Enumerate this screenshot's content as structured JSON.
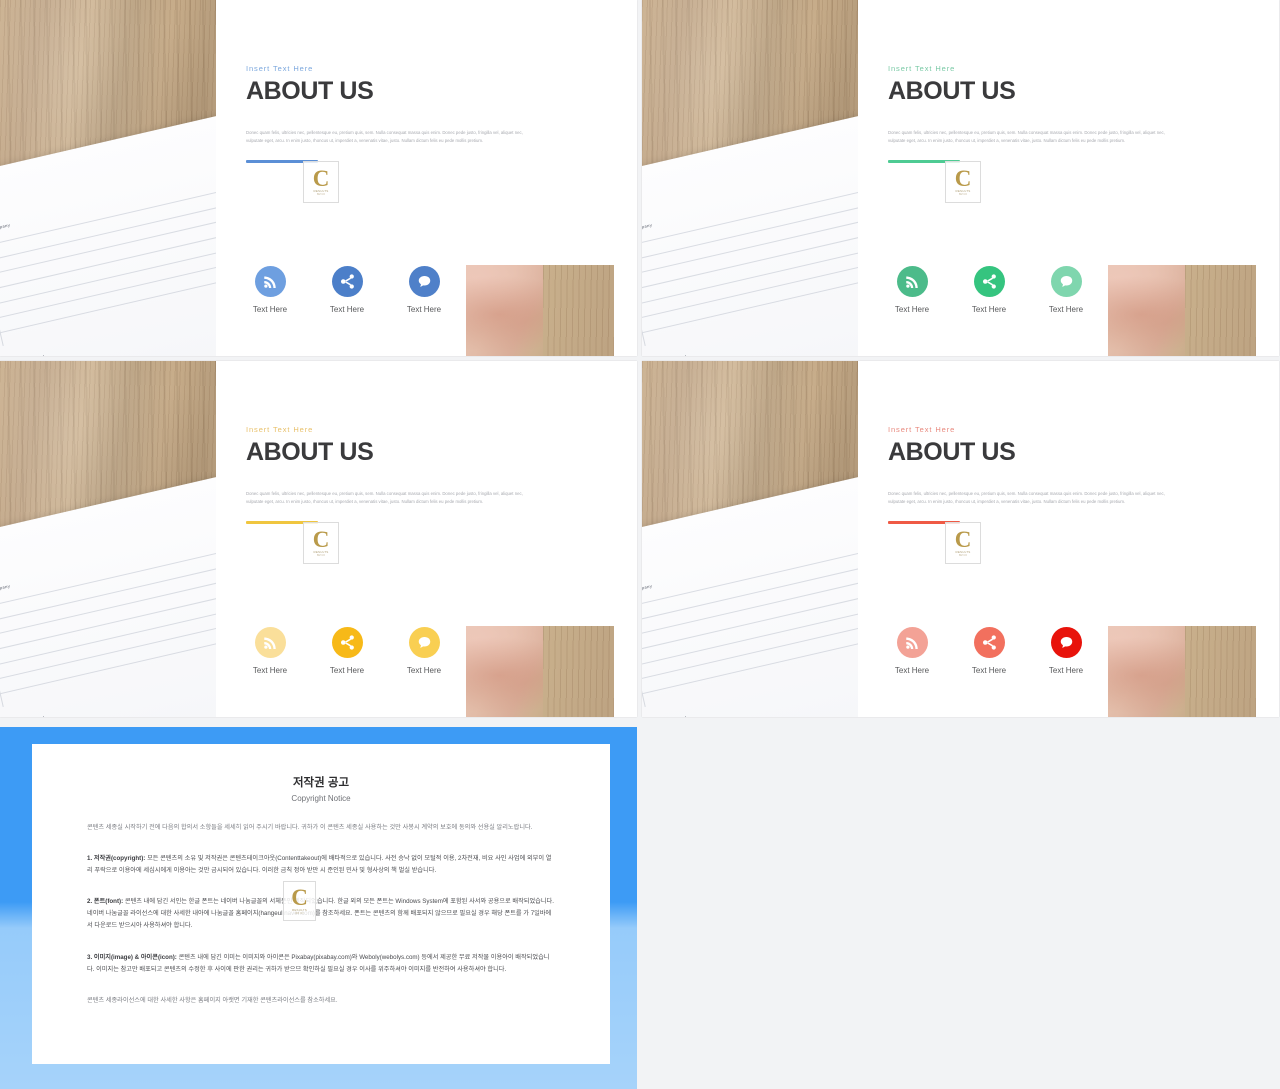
{
  "slides": [
    {
      "id": "slide-blue",
      "eyebrow": "Insert  Text Here",
      "eyebrow_color": "#7ba7dd",
      "headline": "ABOUT US",
      "body": "Donec quam felis, ultricies nec, pellentesque eu, pretium quis, sem. Nulla consequat massa quis enim. Donec pede justo, fringilla vel, aliquet nec, vulputate eget, arcu. In enim justo, rhoncus ut, imperdiet a, venenatis vitae, justo. Nullam dictum felis eu pede mollis pretium.",
      "accent": "#5b8fd6",
      "rule_color": "#5b8fd6",
      "icons": [
        {
          "name": "rss-icon",
          "label": "Text Here",
          "color": "#6e9fe0"
        },
        {
          "name": "share-icon",
          "label": "Text Here",
          "color": "#4c7fc9"
        },
        {
          "name": "chat-icon",
          "label": "Text Here",
          "color": "#4f80c9"
        }
      ]
    },
    {
      "id": "slide-green",
      "eyebrow": "Insert  Text Here",
      "eyebrow_color": "#79c9a5",
      "headline": "ABOUT US",
      "body": "Donec quam felis, ultricies nec, pellentesque eu, pretium quis, sem. Nulla consequat massa quis enim. Donec pede justo, fringilla vel, aliquet nec, vulputate eget, arcu. In enim justo, rhoncus ut, imperdiet a, venenatis vitae, justo. Nullam dictum felis eu pede mollis pretium.",
      "accent": "#4ecb93",
      "rule_color": "#4ecb93",
      "icons": [
        {
          "name": "rss-icon",
          "label": "Text Here",
          "color": "#4cbb8a"
        },
        {
          "name": "share-icon",
          "label": "Text Here",
          "color": "#35c47f"
        },
        {
          "name": "chat-icon",
          "label": "Text Here",
          "color": "#7fd6ae"
        }
      ]
    },
    {
      "id": "slide-yellow",
      "eyebrow": "Insert  Text Here",
      "eyebrow_color": "#e8c06a",
      "headline": "ABOUT US",
      "body": "Donec quam felis, ultricies nec, pellentesque eu, pretium quis, sem. Nulla consequat massa quis enim. Donec pede justo, fringilla vel, aliquet nec, vulputate eget, arcu. In enim justo, rhoncus ut, imperdiet a, venenatis vitae, justo. Nullam dictum felis eu pede mollis pretium.",
      "accent": "#f3cc52",
      "rule_color": "#f0c63f",
      "icons": [
        {
          "name": "rss-icon",
          "label": "Text Here",
          "color": "#fadf9a"
        },
        {
          "name": "share-icon",
          "label": "Text Here",
          "color": "#f7b918"
        },
        {
          "name": "chat-icon",
          "label": "Text Here",
          "color": "#f9cf52"
        }
      ]
    },
    {
      "id": "slide-red",
      "eyebrow": "Insert  Text Here",
      "eyebrow_color": "#e8897e",
      "headline": "ABOUT US",
      "body": "Donec quam felis, ultricies nec, pellentesque eu, pretium quis, sem. Nulla consequat massa quis enim. Donec pede justo, fringilla vel, aliquet nec, vulputate eget, arcu. In enim justo, rhoncus ut, imperdiet a, venenatis vitae, justo. Nullam dictum felis eu pede mollis pretium.",
      "accent": "#f0584a",
      "rule_color": "#ef5a45",
      "icons": [
        {
          "name": "rss-icon",
          "label": "Text Here",
          "color": "#f3a296"
        },
        {
          "name": "share-icon",
          "label": "Text Here",
          "color": "#f2705e"
        },
        {
          "name": "chat-icon",
          "label": "Text Here",
          "color": "#e8130b"
        }
      ]
    }
  ],
  "stamp": {
    "letter": "C",
    "sub": "RESULTS",
    "sub2": "BIZ  CO"
  },
  "photo": {
    "chart_sheet_label_top": "Our company",
    "chart_sheet_label_bottom": "Business trend"
  },
  "copyright": {
    "title_ko": "저작권 공고",
    "title_en": "Copyright Notice",
    "intro": "콘텐츠 세종실 시작하기 전에 다음의 합의서 소항들을 세세히 읽어 주시기 바랍니다. 귀하가 이 콘텐츠 세종실 사용하는 것만 사봉시 계약의 보호에 동의와 선용실 알리노랍니다.",
    "sections": [
      {
        "heading": "1. 저작권(copyright):",
        "text": "모든 콘텐츠의 소유 및 저작권은 콘텐츠테이크아웃(Contenttakeout)에 배타적으로 있습니다. 사전 승낙 없이 모털적 이용, 2차전재, 비요 사인 사업에 외부이 열리 푸락으로 이용아에 세심시에게 이용아는 것만 금시되어 있습니다. 이러한 금칙 정아 받만 시 준인된 민사 및 형사상의 책 벌실 받습니다."
      },
      {
        "heading": "2. 폰트(font):",
        "text": "콘텐츠 내에 담긴 서인는 한글 폰트는 네이버 나눔글꼴의 서체폰인 제작되었습니다. 한글 외의 모든 폰트는 Windows System에 포함된 사서와 공용으로 배작되었습니다. 네이버 나눔글꼴 라이선스에 대한 사세한 내아에 나눔글꼴 홈페이지(hangeul.naver.com)를 참조하세요. 폰트는 콘텐츠의 함께 배포되지 않으므로 필요실 경우 해당 폰트를 가 7일바에서 다운로드 받으시아 사용하셔야 합니다."
      },
      {
        "heading": "3. 이미지(image) & 아이콘(icon):",
        "text": "콘텐츠 내에 담긴 이미는 이미지와 아이콘은 Pixabay(pixabay.com)와 Weboly(webolys.com) 등에서 제공한 무료 저작물 이용아이 배작되었습니다. 이미지는 참고만 배포되고 콘텐츠의 수정한 후 사이에 판한 권리는 귀하가 받으므 확인하실 필요실 경우 이사를 위주하셔야 이미지를 반전하여 사용하셔야 합니다."
      }
    ],
    "outro": "콘텐츠 세종라이선스에 대한 사세한 사항은 홈페이지 아랫면 기재한 콘텐츠라이선스를 참소하세요."
  }
}
